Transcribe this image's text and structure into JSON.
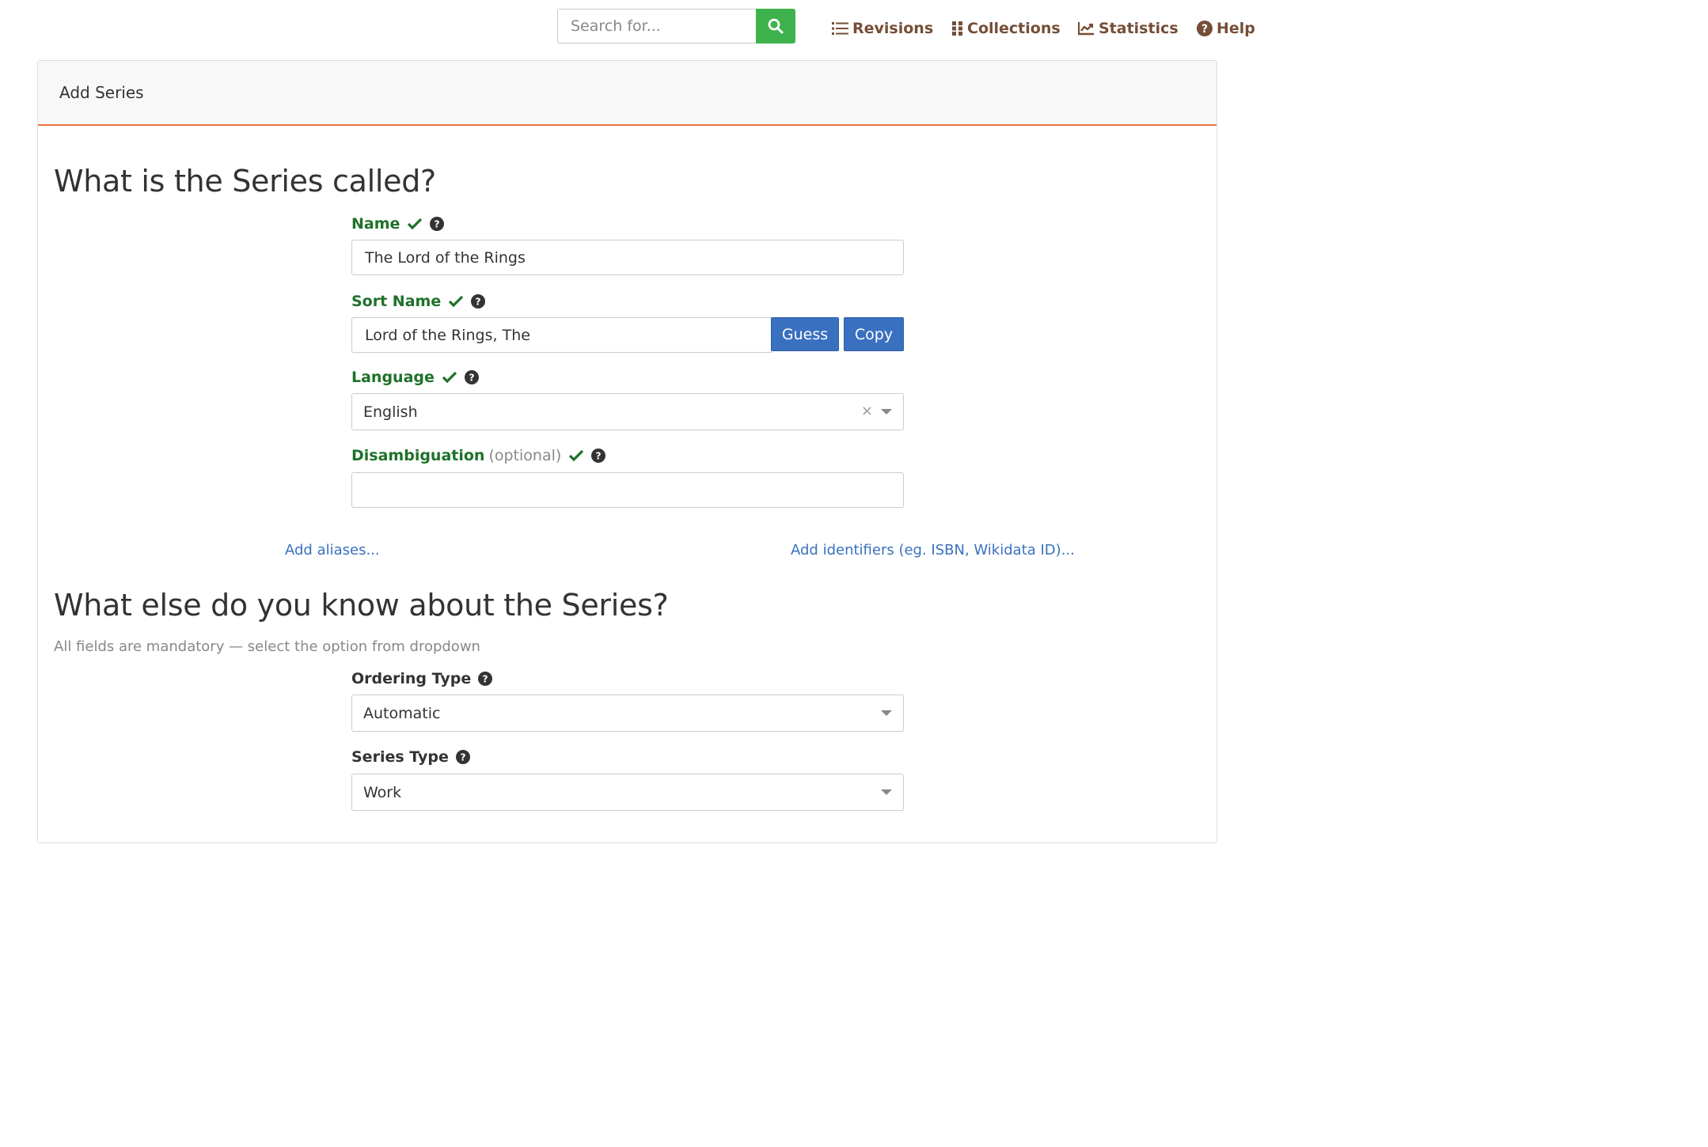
{
  "nav": {
    "search_placeholder": "Search for...",
    "links": [
      {
        "label": "Revisions",
        "icon": "list-icon"
      },
      {
        "label": "Collections",
        "icon": "grid-icon"
      },
      {
        "label": "Statistics",
        "icon": "chart-line-icon"
      },
      {
        "label": "Help",
        "icon": "question-circle-icon"
      }
    ]
  },
  "card": {
    "header": "Add Series"
  },
  "section1": {
    "title": "What is the Series called?",
    "name": {
      "label": "Name",
      "value": "The Lord of the Rings"
    },
    "sort_name": {
      "label": "Sort Name",
      "value": "Lord of the Rings, The",
      "guess_label": "Guess",
      "copy_label": "Copy"
    },
    "language": {
      "label": "Language",
      "value": "English",
      "clear": "×"
    },
    "disambiguation": {
      "label": "Disambiguation",
      "optional": "(optional)",
      "value": ""
    },
    "add_aliases": "Add aliases...",
    "add_identifiers": "Add identifiers (eg. ISBN, Wikidata ID)..."
  },
  "section2": {
    "title": "What else do you know about the Series?",
    "help": "All fields are mandatory — select the option from dropdown",
    "ordering_type": {
      "label": "Ordering Type",
      "value": "Automatic"
    },
    "series_type": {
      "label": "Series Type",
      "value": "Work"
    }
  },
  "colors": {
    "brand_brown": "#754e37",
    "search_green": "#3eb34d",
    "valid_green": "#1e7129",
    "accent_orange": "#eb743b",
    "primary_blue": "#3a70c0"
  }
}
